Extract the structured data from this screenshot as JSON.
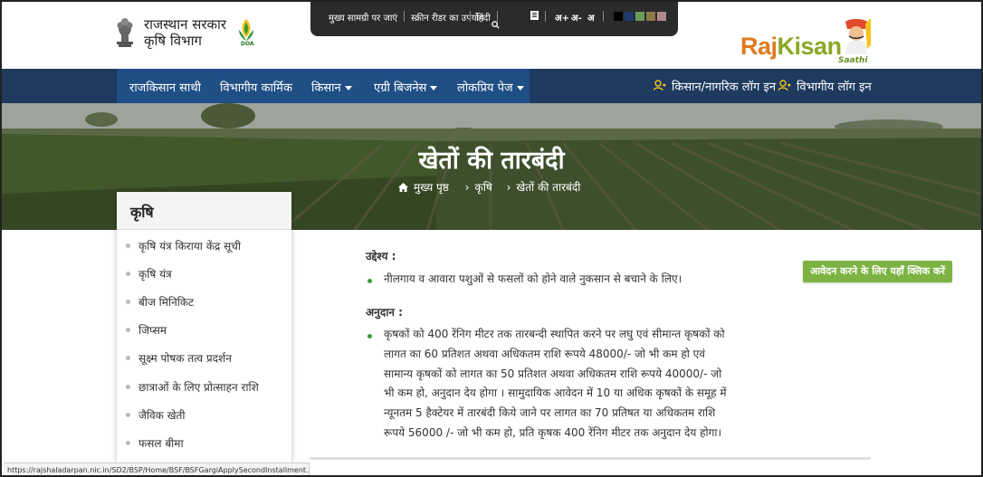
{
  "header": {
    "gov_line1": "राजस्थान सरकार",
    "gov_line2": "कृषि विभाग",
    "doa_label": "DOA"
  },
  "topbar": {
    "skip_main": "मुख्य सामग्री पर जाएं",
    "screen_reader": "स्क्रीन रीडर का उपयोग",
    "language": "हिंदी",
    "font_increase": "अ+",
    "font_decrease": "अ-",
    "font_normal": "अ",
    "theme_colors": [
      "#000000",
      "#1f3b6e",
      "#6a9a5a",
      "#8a7a4a",
      "#b08a8a"
    ]
  },
  "brand": {
    "raj": "Raj",
    "kisan": "Kisan",
    "saathi": "Saathi"
  },
  "nav": {
    "items": [
      {
        "label": "राजकिसान साथी",
        "dropdown": false
      },
      {
        "label": "विभागीय कार्मिक",
        "dropdown": false
      },
      {
        "label": "किसान",
        "dropdown": true
      },
      {
        "label": "एग्री बिजनेस",
        "dropdown": true
      },
      {
        "label": "लोकप्रिय पेज",
        "dropdown": true
      }
    ],
    "login_citizen": "किसान/नागरिक लॉग इन",
    "login_dept": "विभागीय लॉग इन"
  },
  "hero": {
    "title": "खेतों की तारबंदी",
    "breadcrumb": [
      "मुख्य पृष्ठ",
      "कृषि",
      "खेतों की तारबंदी"
    ]
  },
  "sidebar": {
    "title": "कृषि",
    "items": [
      "कृषि यंत्र किराया केंद्र सूची",
      "कृषि यंत्र",
      "बीज मिनिकिट",
      "जिप्सम",
      "सूक्ष्म पोषक तत्व प्रदर्शन",
      "छात्राओं के लिए प्रोत्साहन राशि",
      "जैविक खेती",
      "फसल बीमा"
    ]
  },
  "main": {
    "objective_label": "उद्देश्य :",
    "objective_text": "नीलगाय व आवारा पशुओं से फसलों को होने वाले नुकसान से बचाने के लिए।",
    "grant_label": "अनुदान :",
    "grant_text": "कृषकों को 400 रेंनिग मीटर तक तारबन्दी स्थापित करने पर लघु एवं सीमान्त कृषकों को लागत का 60 प्रतिशत अथवा अधिकतम राशि रूपये 48000/- जो भी कम हो एवं सामान्य कृषकों को लागत का 50 प्रतिशत अथवा अधिकतम राशि रूपये 40000/- जो भी कम हो, अनुदान देय होगा । सामुदायिक आवेदन में 10 या अधिक कृषकों के समूह में न्यूनतम 5 हैक्टेयर में तारबंदी किये जाने पर लागत का 70 प्रतिषत या अधिकतम राशि रूपये 56000 /- जो भी कम हो, प्रति कृषक 400 रेंनिग मीटर तक अनुदान देय होगा।",
    "apply_button": "आवेदन करने के लिए यहाँ क्लिक करें"
  },
  "status_bar": {
    "url": "https://rajshaladarpan.nic.in/SD2/BSP/Home/BSF/BSFGargiApplySecondInstallment.aspx"
  }
}
